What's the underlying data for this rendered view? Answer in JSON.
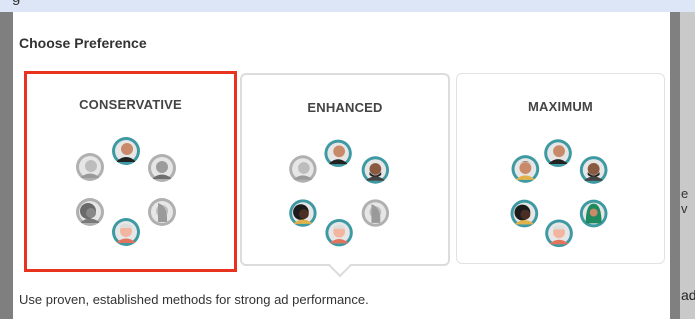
{
  "top_strip_text": "g",
  "dialog": {
    "title": "Choose Preference",
    "description": "Use proven, established methods for strong ad performance."
  },
  "options": [
    {
      "label": "CONSERVATIVE",
      "selected": true
    },
    {
      "label": "ENHANCED",
      "selected": false
    },
    {
      "label": "MAXIMUM",
      "selected": false
    }
  ],
  "background_fragments": {
    "right_text_1": "e v",
    "right_text_2": "ad"
  },
  "colors": {
    "selection_border": "#e8331f",
    "avatar_ring_teal": "#3e9aa2",
    "avatar_ring_gray": "#b0b0b0",
    "skin_tan": "#c98a6a",
    "skin_peach": "#f2b5a0",
    "skin_dark": "#4a2e24"
  },
  "icons": [
    "person-avatar-icon"
  ]
}
